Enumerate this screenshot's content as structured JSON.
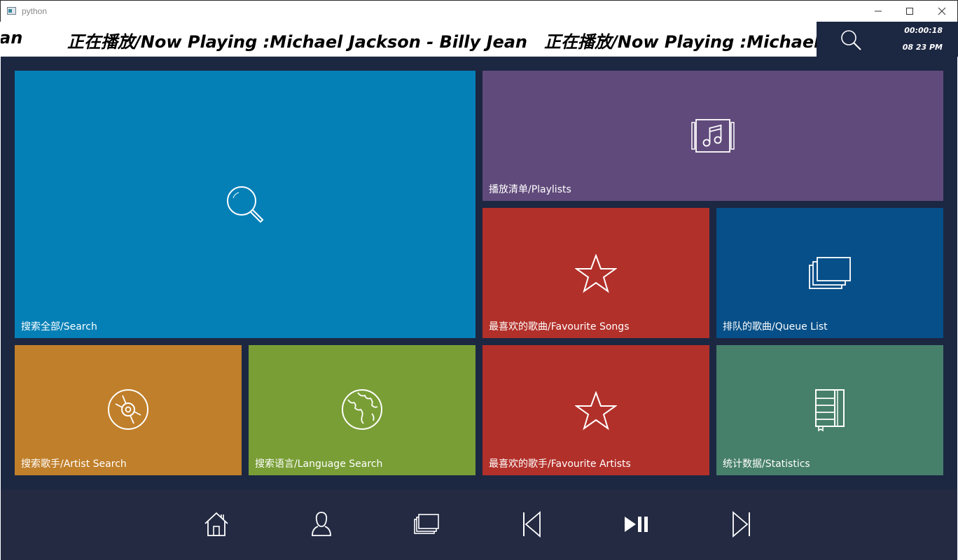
{
  "window": {
    "title": "python"
  },
  "header": {
    "now_playing": "正在播放/Now Playing :Michael Jackson - Billy Jean",
    "now_playing_partial_left": "an",
    "now_playing_partial_right": "正在播放/Now Playing :Michael J",
    "elapsed": "00:00:18",
    "clock": "08 23 PM",
    "search_icon": "search-icon"
  },
  "tiles": [
    {
      "label": "搜索全部/Search",
      "icon": "search-icon",
      "color": "#0580b7"
    },
    {
      "label": "播放清单/Playlists",
      "icon": "music-album-icon",
      "color": "#604a7b"
    },
    {
      "label": "最喜欢的歌曲/Favourite Songs",
      "icon": "star-icon",
      "color": "#b2302a"
    },
    {
      "label": "排队的歌曲/Queue List",
      "icon": "stack-windows-icon",
      "color": "#064f88"
    },
    {
      "label": "搜索歌手/Artist Search",
      "icon": "disc-icon",
      "color": "#c07f2a"
    },
    {
      "label": "搜索语言/Language Search",
      "icon": "globe-icon",
      "color": "#799e36"
    },
    {
      "label": "最喜欢的歌手/Favourite Artists",
      "icon": "star-icon",
      "color": "#b2302a"
    },
    {
      "label": "统计数据/Statistics",
      "icon": "notebook-icon",
      "color": "#467f6a"
    }
  ],
  "bottom_nav": [
    {
      "name": "home",
      "icon": "home-icon"
    },
    {
      "name": "artist",
      "icon": "user-icon"
    },
    {
      "name": "queue",
      "icon": "stack-windows-icon"
    },
    {
      "name": "previous",
      "icon": "skip-previous-icon"
    },
    {
      "name": "play-pause",
      "icon": "play-pause-icon"
    },
    {
      "name": "next",
      "icon": "skip-next-icon"
    }
  ],
  "colors": {
    "background": "#1c2742",
    "bottom_bar": "#232a42",
    "text": "#ffffff"
  }
}
